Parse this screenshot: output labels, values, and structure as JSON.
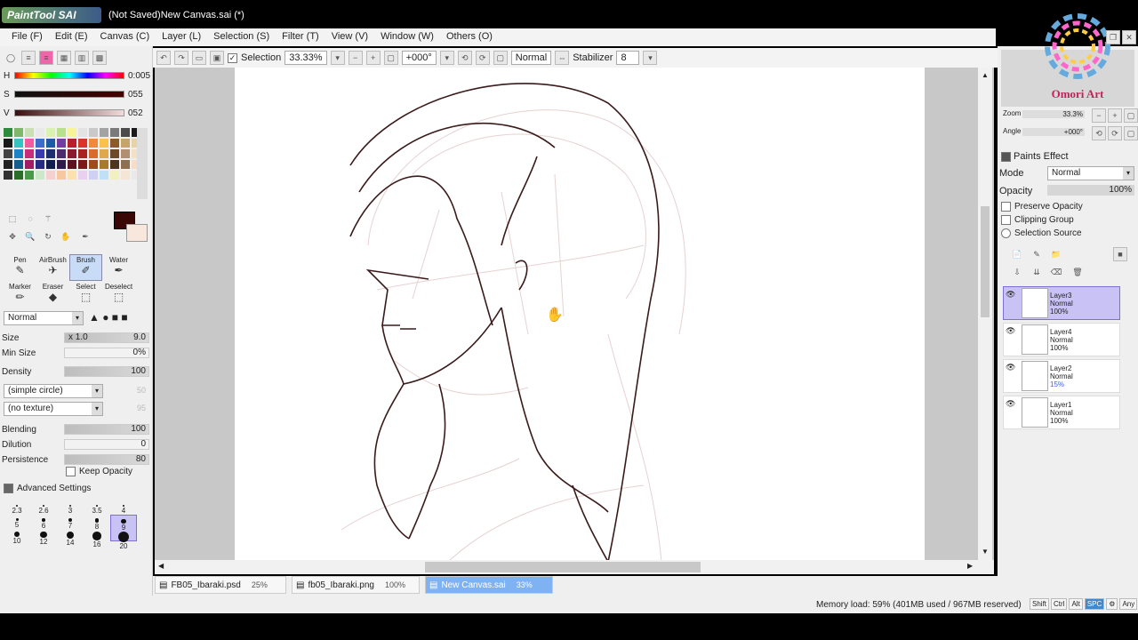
{
  "window": {
    "app_logo": "PaintTool SAI",
    "title": "(Not Saved)New Canvas.sai (*)"
  },
  "menu": [
    "File (F)",
    "Edit (E)",
    "Canvas (C)",
    "Layer (L)",
    "Selection (S)",
    "Filter (T)",
    "View (V)",
    "Window (W)",
    "Others (O)"
  ],
  "toolbar": {
    "selection_label": "Selection",
    "zoom": "33.33%",
    "angle": "+000°",
    "mode": "Normal",
    "stabilizer_label": "Stabilizer",
    "stabilizer_value": "8"
  },
  "color_sliders": [
    {
      "label": "H",
      "value": "0:005"
    },
    {
      "label": "S",
      "value": "055"
    },
    {
      "label": "V",
      "value": "052"
    }
  ],
  "palette_colors": [
    "#2e8b3c",
    "#7fb86a",
    "#c9e0b5",
    "#e9e9e9",
    "#d9f2b0",
    "#b9e08a",
    "#f7f49a",
    "#e3e3e3",
    "#c9c9c9",
    "#a3a3a3",
    "#7a7a7a",
    "#4b4b4b",
    "#1b1b1b",
    "#1a1a1a",
    "#39c0c0",
    "#f25c9c",
    "#3b6ec9",
    "#1f5aa8",
    "#6e3fa0",
    "#b71e2e",
    "#d9342b",
    "#f08a3a",
    "#f8c34a",
    "#8c5a2e",
    "#c7a46d",
    "#e6d3a8",
    "#444444",
    "#1a84c7",
    "#c92c7a",
    "#3a3ab0",
    "#1b2d6e",
    "#4d2a6e",
    "#8a1a2e",
    "#a82222",
    "#d96c2b",
    "#e0a84a",
    "#6e4a2a",
    "#b09070",
    "#f3e0c8",
    "#222222",
    "#15608a",
    "#a01e5e",
    "#2a2a80",
    "#141e4e",
    "#2f1a4e",
    "#5e1220",
    "#7e1818",
    "#a24a1e",
    "#a87a30",
    "#4e3420",
    "#8e7050",
    "#f5ddc9",
    "#333333",
    "#2a6e2a",
    "#4a9a4a",
    "#cde8c9",
    "#f5d0d0",
    "#f7c8a0",
    "#fbe0b0",
    "#e8d0f0",
    "#d0d0f5",
    "#c0e0f5",
    "#f0f0c0",
    "#f5e5d5",
    "#e9e9e9"
  ],
  "tools": [
    {
      "name": "Pen",
      "glyph": "✎"
    },
    {
      "name": "AirBrush",
      "glyph": "✈"
    },
    {
      "name": "Brush",
      "glyph": "✐"
    },
    {
      "name": "Water",
      "glyph": "✒"
    },
    {
      "name": "Marker",
      "glyph": "✏"
    },
    {
      "name": "Eraser",
      "glyph": "◆"
    },
    {
      "name": "Select",
      "glyph": "⬚"
    },
    {
      "name": "Deselect",
      "glyph": "⬚"
    }
  ],
  "brush": {
    "blend_mode": "Normal",
    "size_label": "Size",
    "size_mult": "x 1.0",
    "size_value": "9.0",
    "min_size_label": "Min Size",
    "min_size_value": "0%",
    "density_label": "Density",
    "density_value": "100",
    "shape": "(simple circle)",
    "shape_val": "50",
    "texture": "(no texture)",
    "texture_val": "95",
    "blending_label": "Blending",
    "blending_value": "100",
    "dilution_label": "Dilution",
    "dilution_value": "0",
    "persistence_label": "Persistence",
    "persistence_value": "80",
    "keep_opacity_label": "Keep Opacity",
    "advanced_label": "Advanced Settings"
  },
  "brush_sizes": [
    "2.3",
    "2.6",
    "3",
    "3.5",
    "4",
    "5",
    "6",
    "7",
    "8",
    "9",
    "10",
    "12",
    "14",
    "16",
    "20"
  ],
  "navigator": {
    "watermark": "Omori Art",
    "zoom_label": "Zoom",
    "zoom_value": "33.3%",
    "angle_label": "Angle",
    "angle_value": "+000°"
  },
  "layer_panel": {
    "paints_effect": "Paints Effect",
    "mode_label": "Mode",
    "mode_value": "Normal",
    "opacity_label": "Opacity",
    "opacity_value": "100%",
    "preserve_opacity": "Preserve Opacity",
    "clipping_group": "Clipping Group",
    "selection_source": "Selection Source"
  },
  "layers": [
    {
      "name": "Layer3",
      "mode": "Normal",
      "opacity": "100%",
      "selected": true
    },
    {
      "name": "Layer4",
      "mode": "Normal",
      "opacity": "100%",
      "selected": false
    },
    {
      "name": "Layer2",
      "mode": "Normal",
      "opacity": "15%",
      "selected": false
    },
    {
      "name": "Layer1",
      "mode": "Normal",
      "opacity": "100%",
      "selected": false
    }
  ],
  "tabs": [
    {
      "name": "FB05_Ibaraki.psd",
      "pct": "25%",
      "active": false
    },
    {
      "name": "fb05_Ibaraki.png",
      "pct": "100%",
      "active": false
    },
    {
      "name": "New Canvas.sai",
      "pct": "33%",
      "active": true
    }
  ],
  "status": {
    "memory": "Memory load: 59% (401MB used / 967MB reserved)",
    "keys": [
      "Shift",
      "Ctrl",
      "Alt",
      "SPC",
      "⚙",
      "Any"
    ],
    "active_key": "SPC"
  }
}
